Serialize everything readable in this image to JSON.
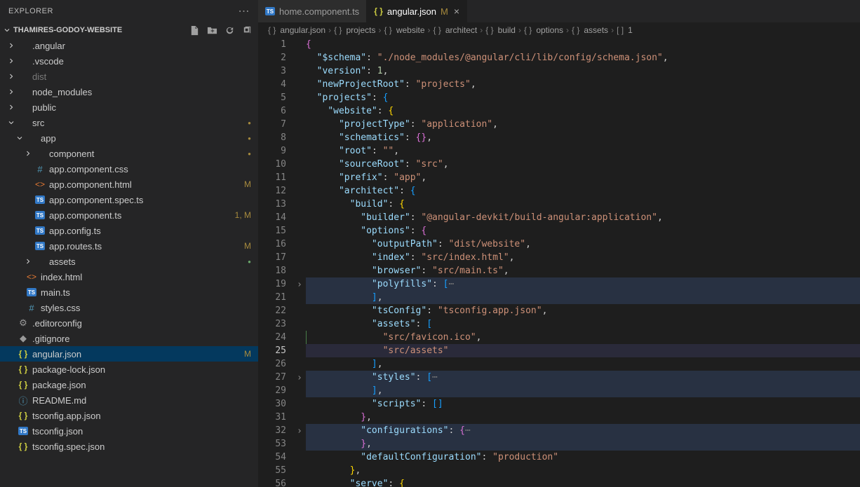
{
  "explorer": {
    "title": "EXPLORER",
    "project": "THAMIRES-GODOY-WEBSITE",
    "tree": [
      {
        "type": "folder",
        "name": ".angular",
        "depth": 0,
        "open": false
      },
      {
        "type": "folder",
        "name": ".vscode",
        "depth": 0,
        "open": false
      },
      {
        "type": "folder",
        "name": "dist",
        "depth": 0,
        "open": false,
        "dim": true
      },
      {
        "type": "folder",
        "name": "node_modules",
        "depth": 0,
        "open": false
      },
      {
        "type": "folder",
        "name": "public",
        "depth": 0,
        "open": false
      },
      {
        "type": "folder",
        "name": "src",
        "depth": 0,
        "open": true,
        "dot": "yellow"
      },
      {
        "type": "folder",
        "name": "app",
        "depth": 1,
        "open": true,
        "dot": "yellow"
      },
      {
        "type": "folder",
        "name": "component",
        "depth": 2,
        "open": false,
        "dot": "yellow"
      },
      {
        "type": "file",
        "name": "app.component.css",
        "depth": 2,
        "icon": "hash"
      },
      {
        "type": "file",
        "name": "app.component.html",
        "depth": 2,
        "icon": "html",
        "status": "M"
      },
      {
        "type": "file",
        "name": "app.component.spec.ts",
        "depth": 2,
        "icon": "ts"
      },
      {
        "type": "file",
        "name": "app.component.ts",
        "depth": 2,
        "icon": "ts",
        "status": "1, M"
      },
      {
        "type": "file",
        "name": "app.config.ts",
        "depth": 2,
        "icon": "ts"
      },
      {
        "type": "file",
        "name": "app.routes.ts",
        "depth": 2,
        "icon": "ts",
        "status": "M"
      },
      {
        "type": "folder",
        "name": "assets",
        "depth": 2,
        "open": false,
        "dot": "green"
      },
      {
        "type": "file",
        "name": "index.html",
        "depth": 1,
        "icon": "html"
      },
      {
        "type": "file",
        "name": "main.ts",
        "depth": 1,
        "icon": "ts"
      },
      {
        "type": "file",
        "name": "styles.css",
        "depth": 1,
        "icon": "hash"
      },
      {
        "type": "file",
        "name": ".editorconfig",
        "depth": 0,
        "icon": "gear"
      },
      {
        "type": "file",
        "name": ".gitignore",
        "depth": 0,
        "icon": "git"
      },
      {
        "type": "file",
        "name": "angular.json",
        "depth": 0,
        "icon": "braces",
        "status": "M",
        "selected": true
      },
      {
        "type": "file",
        "name": "package-lock.json",
        "depth": 0,
        "icon": "braces"
      },
      {
        "type": "file",
        "name": "package.json",
        "depth": 0,
        "icon": "braces"
      },
      {
        "type": "file",
        "name": "README.md",
        "depth": 0,
        "icon": "info"
      },
      {
        "type": "file",
        "name": "tsconfig.app.json",
        "depth": 0,
        "icon": "braces"
      },
      {
        "type": "file",
        "name": "tsconfig.json",
        "depth": 0,
        "icon": "ts"
      },
      {
        "type": "file",
        "name": "tsconfig.spec.json",
        "depth": 0,
        "icon": "braces"
      }
    ]
  },
  "tabs": [
    {
      "label": "home.component.ts",
      "icon": "ts",
      "active": false
    },
    {
      "label": "angular.json",
      "icon": "braces",
      "active": true,
      "modified": "M",
      "close": true
    }
  ],
  "breadcrumbs": [
    "angular.json",
    "projects",
    "website",
    "architect",
    "build",
    "options",
    "assets",
    "1"
  ],
  "code": {
    "currentLine": 25,
    "lines": [
      {
        "n": 1,
        "indent": 0,
        "tokens": [
          [
            "brace",
            "{"
          ]
        ]
      },
      {
        "n": 2,
        "indent": 1,
        "tokens": [
          [
            "key",
            "\"$schema\""
          ],
          [
            "punc",
            ": "
          ],
          [
            "str",
            "\"./node_modules/@angular/cli/lib/config/schema.json\""
          ],
          [
            "punc",
            ","
          ]
        ]
      },
      {
        "n": 3,
        "indent": 1,
        "tokens": [
          [
            "key",
            "\"version\""
          ],
          [
            "punc",
            ": "
          ],
          [
            "num",
            "1"
          ],
          [
            "punc",
            ","
          ]
        ]
      },
      {
        "n": 4,
        "indent": 1,
        "tokens": [
          [
            "key",
            "\"newProjectRoot\""
          ],
          [
            "punc",
            ": "
          ],
          [
            "str",
            "\"projects\""
          ],
          [
            "punc",
            ","
          ]
        ]
      },
      {
        "n": 5,
        "indent": 1,
        "tokens": [
          [
            "key",
            "\"projects\""
          ],
          [
            "punc",
            ": "
          ],
          [
            "brace2",
            "{"
          ]
        ]
      },
      {
        "n": 6,
        "indent": 2,
        "tokens": [
          [
            "key",
            "\"website\""
          ],
          [
            "punc",
            ": "
          ],
          [
            "brace3",
            "{"
          ]
        ]
      },
      {
        "n": 7,
        "indent": 3,
        "tokens": [
          [
            "key",
            "\"projectType\""
          ],
          [
            "punc",
            ": "
          ],
          [
            "str",
            "\"application\""
          ],
          [
            "punc",
            ","
          ]
        ]
      },
      {
        "n": 8,
        "indent": 3,
        "tokens": [
          [
            "key",
            "\"schematics\""
          ],
          [
            "punc",
            ": "
          ],
          [
            "brace",
            "{}"
          ],
          [
            "punc",
            ","
          ]
        ]
      },
      {
        "n": 9,
        "indent": 3,
        "tokens": [
          [
            "key",
            "\"root\""
          ],
          [
            "punc",
            ": "
          ],
          [
            "str",
            "\"\""
          ],
          [
            "punc",
            ","
          ]
        ]
      },
      {
        "n": 10,
        "indent": 3,
        "tokens": [
          [
            "key",
            "\"sourceRoot\""
          ],
          [
            "punc",
            ": "
          ],
          [
            "str",
            "\"src\""
          ],
          [
            "punc",
            ","
          ]
        ]
      },
      {
        "n": 11,
        "indent": 3,
        "tokens": [
          [
            "key",
            "\"prefix\""
          ],
          [
            "punc",
            ": "
          ],
          [
            "str",
            "\"app\""
          ],
          [
            "punc",
            ","
          ]
        ]
      },
      {
        "n": 12,
        "indent": 3,
        "tokens": [
          [
            "key",
            "\"architect\""
          ],
          [
            "punc",
            ": "
          ],
          [
            "brace2",
            "{"
          ]
        ]
      },
      {
        "n": 13,
        "indent": 4,
        "tokens": [
          [
            "key",
            "\"build\""
          ],
          [
            "punc",
            ": "
          ],
          [
            "brace3",
            "{"
          ]
        ]
      },
      {
        "n": 14,
        "indent": 5,
        "tokens": [
          [
            "key",
            "\"builder\""
          ],
          [
            "punc",
            ": "
          ],
          [
            "str",
            "\"@angular-devkit/build-angular:application\""
          ],
          [
            "punc",
            ","
          ]
        ]
      },
      {
        "n": 15,
        "indent": 5,
        "tokens": [
          [
            "key",
            "\"options\""
          ],
          [
            "punc",
            ": "
          ],
          [
            "brace",
            "{"
          ]
        ]
      },
      {
        "n": 16,
        "indent": 6,
        "tokens": [
          [
            "key",
            "\"outputPath\""
          ],
          [
            "punc",
            ": "
          ],
          [
            "str",
            "\"dist/website\""
          ],
          [
            "punc",
            ","
          ]
        ]
      },
      {
        "n": 17,
        "indent": 6,
        "tokens": [
          [
            "key",
            "\"index\""
          ],
          [
            "punc",
            ": "
          ],
          [
            "str",
            "\"src/index.html\""
          ],
          [
            "punc",
            ","
          ]
        ]
      },
      {
        "n": 18,
        "indent": 6,
        "tokens": [
          [
            "key",
            "\"browser\""
          ],
          [
            "punc",
            ": "
          ],
          [
            "str",
            "\"src/main.ts\""
          ],
          [
            "punc",
            ","
          ]
        ]
      },
      {
        "n": 19,
        "indent": 6,
        "fold": true,
        "hl": true,
        "tokens": [
          [
            "key",
            "\"polyfills\""
          ],
          [
            "punc",
            ": "
          ],
          [
            "brace2",
            "["
          ],
          [
            "fold",
            "⋯"
          ]
        ]
      },
      {
        "n": 21,
        "indent": 6,
        "hl": true,
        "tokens": [
          [
            "brace2",
            "]"
          ],
          [
            "punc",
            ","
          ]
        ]
      },
      {
        "n": 22,
        "indent": 6,
        "tokens": [
          [
            "key",
            "\"tsConfig\""
          ],
          [
            "punc",
            ": "
          ],
          [
            "str",
            "\"tsconfig.app.json\""
          ],
          [
            "punc",
            ","
          ]
        ]
      },
      {
        "n": 23,
        "indent": 6,
        "tokens": [
          [
            "key",
            "\"assets\""
          ],
          [
            "punc",
            ": "
          ],
          [
            "brace2",
            "["
          ]
        ]
      },
      {
        "n": 24,
        "indent": 7,
        "mod": true,
        "tokens": [
          [
            "str",
            "\"src/favicon.ico\""
          ],
          [
            "punc",
            ","
          ]
        ]
      },
      {
        "n": 25,
        "indent": 7,
        "cur": true,
        "tokens": [
          [
            "str",
            "\"src/assets\""
          ]
        ]
      },
      {
        "n": 26,
        "indent": 6,
        "tokens": [
          [
            "brace2",
            "]"
          ],
          [
            "punc",
            ","
          ]
        ]
      },
      {
        "n": 27,
        "indent": 6,
        "fold": true,
        "hl": true,
        "tokens": [
          [
            "key",
            "\"styles\""
          ],
          [
            "punc",
            ": "
          ],
          [
            "brace2",
            "["
          ],
          [
            "fold",
            "⋯"
          ]
        ]
      },
      {
        "n": 29,
        "indent": 6,
        "hl": true,
        "tokens": [
          [
            "brace2",
            "]"
          ],
          [
            "punc",
            ","
          ]
        ]
      },
      {
        "n": 30,
        "indent": 6,
        "tokens": [
          [
            "key",
            "\"scripts\""
          ],
          [
            "punc",
            ": "
          ],
          [
            "brace2",
            "[]"
          ]
        ]
      },
      {
        "n": 31,
        "indent": 5,
        "tokens": [
          [
            "brace",
            "}"
          ],
          [
            "punc",
            ","
          ]
        ]
      },
      {
        "n": 32,
        "indent": 5,
        "fold": true,
        "hl": true,
        "tokens": [
          [
            "key",
            "\"configurations\""
          ],
          [
            "punc",
            ": "
          ],
          [
            "brace",
            "{"
          ],
          [
            "fold",
            "⋯"
          ]
        ]
      },
      {
        "n": 53,
        "indent": 5,
        "hl": true,
        "tokens": [
          [
            "brace",
            "}"
          ],
          [
            "punc",
            ","
          ]
        ]
      },
      {
        "n": 54,
        "indent": 5,
        "tokens": [
          [
            "key",
            "\"defaultConfiguration\""
          ],
          [
            "punc",
            ": "
          ],
          [
            "str",
            "\"production\""
          ]
        ]
      },
      {
        "n": 55,
        "indent": 4,
        "tokens": [
          [
            "brace3",
            "}"
          ],
          [
            "punc",
            ","
          ]
        ]
      },
      {
        "n": 56,
        "indent": 4,
        "tokens": [
          [
            "key",
            "\"serve\""
          ],
          [
            "punc",
            ": "
          ],
          [
            "brace3",
            "{"
          ]
        ]
      }
    ]
  }
}
